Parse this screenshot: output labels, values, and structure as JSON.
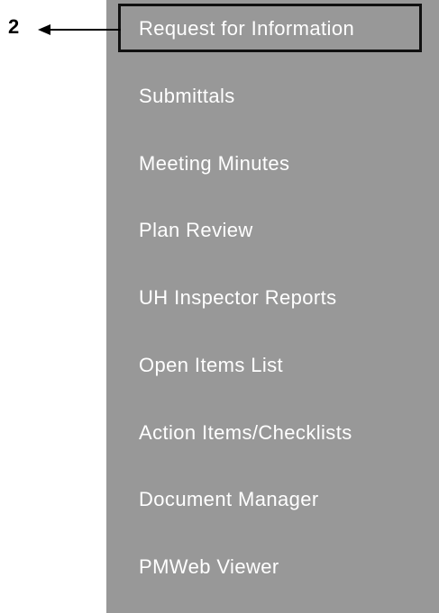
{
  "annotation": {
    "number": "2"
  },
  "menu": {
    "items": [
      {
        "label": "Request for Information"
      },
      {
        "label": "Submittals"
      },
      {
        "label": "Meeting Minutes"
      },
      {
        "label": "Plan Review"
      },
      {
        "label": "UH Inspector Reports"
      },
      {
        "label": "Open Items List"
      },
      {
        "label": "Action Items/Checklists"
      },
      {
        "label": "Document Manager"
      },
      {
        "label": "PMWeb Viewer"
      }
    ],
    "highlighted_item": "Request for Information"
  },
  "colors": {
    "panel_background": "#989898",
    "item_text": "#ffffff",
    "highlight_border": "#111111",
    "annotation": "#000000"
  }
}
